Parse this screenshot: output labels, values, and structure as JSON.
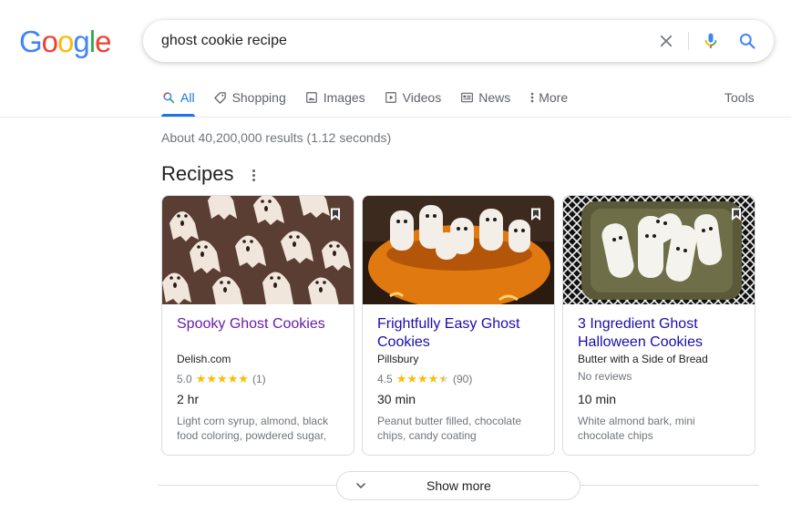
{
  "logo": {
    "letters": [
      "G",
      "o",
      "o",
      "g",
      "l",
      "e"
    ],
    "colors": [
      "#4285F4",
      "#EA4335",
      "#FBBC05",
      "#4285F4",
      "#34A853",
      "#EA4335"
    ]
  },
  "search": {
    "query": "ghost cookie recipe",
    "clear_icon": "close-icon",
    "mic_icon": "mic-icon",
    "search_icon": "search-icon"
  },
  "tabs": [
    {
      "label": "All",
      "icon": "search-icon",
      "active": true
    },
    {
      "label": "Shopping",
      "icon": "tag-icon"
    },
    {
      "label": "Images",
      "icon": "image-icon"
    },
    {
      "label": "Videos",
      "icon": "play-icon"
    },
    {
      "label": "News",
      "icon": "news-icon"
    },
    {
      "label": "More",
      "icon": "more-vert-icon"
    }
  ],
  "tools_label": "Tools",
  "result_stats": "About 40,200,000 results (1.12 seconds)",
  "section": {
    "title": "Recipes"
  },
  "recipes": [
    {
      "title": "Spooky Ghost Cookies",
      "source": "Delish.com",
      "rating": "5.0",
      "stars": 5,
      "reviews": "(1)",
      "time": "2 hr",
      "ingredients": "Light corn syrup, almond, black food coloring, powdered sugar,",
      "visited": true
    },
    {
      "title": "Frightfully Easy Ghost Cookies",
      "source": "Pillsbury",
      "rating": "4.5",
      "stars": 4.5,
      "reviews": "(90)",
      "time": "30 min",
      "ingredients": "Peanut butter filled, chocolate chips, candy coating",
      "visited": false
    },
    {
      "title": "3 Ingredient Ghost Halloween Cookies",
      "source": "Butter with a Side of Bread",
      "no_reviews": "No reviews",
      "time": "10 min",
      "ingredients": "White almond bark, mini chocolate chips",
      "visited": false
    }
  ],
  "show_more_label": "Show more",
  "colors": {
    "link": "#1a0dab",
    "visited": "#681da8",
    "accent": "#1a73e8",
    "star": "#fbbc04"
  }
}
